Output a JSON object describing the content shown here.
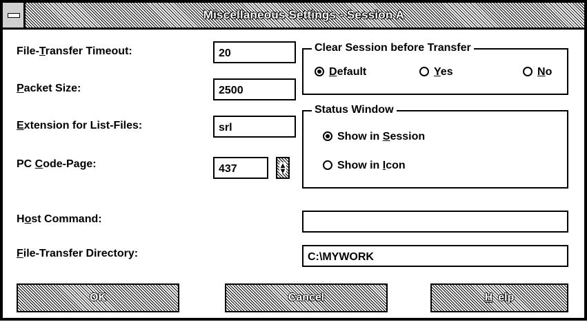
{
  "window": {
    "title": "Miscellaneous Settings - Session A"
  },
  "form": {
    "file_transfer_timeout": {
      "label_pre": "File-",
      "label_u": "T",
      "label_post": "ransfer Timeout:",
      "value": "20"
    },
    "packet_size": {
      "label_pre": "",
      "label_u": "P",
      "label_post": "acket Size:",
      "value": "2500"
    },
    "extension_list_files": {
      "label_pre": "",
      "label_u": "E",
      "label_post": "xtension for List-Files:",
      "value": "srl"
    },
    "pc_code_page": {
      "label_pre": "PC ",
      "label_u": "C",
      "label_post": "ode-Page:",
      "value": "437"
    },
    "host_command": {
      "label_pre": "H",
      "label_u": "o",
      "label_post": "st Command:",
      "value": ""
    },
    "file_transfer_directory": {
      "label_pre": "",
      "label_u": "F",
      "label_post": "ile-Transfer Directory:",
      "value": "C:\\MYWORK"
    }
  },
  "clear_session": {
    "title": "Clear Session before Transfer",
    "options": [
      {
        "u": "D",
        "rest": "efault",
        "selected": true
      },
      {
        "u": "Y",
        "rest": "es",
        "selected": false
      },
      {
        "u": "N",
        "rest": "o",
        "selected": false
      }
    ]
  },
  "status_window": {
    "title": "Status Window",
    "options": [
      {
        "pre": "Show in ",
        "u": "S",
        "rest": "ession",
        "selected": true
      },
      {
        "pre": "Show in ",
        "u": "I",
        "rest": "con",
        "selected": false
      }
    ]
  },
  "buttons": {
    "ok": "OK",
    "cancel": "Cancel",
    "help_u": "H",
    "help_rest": "elp"
  }
}
